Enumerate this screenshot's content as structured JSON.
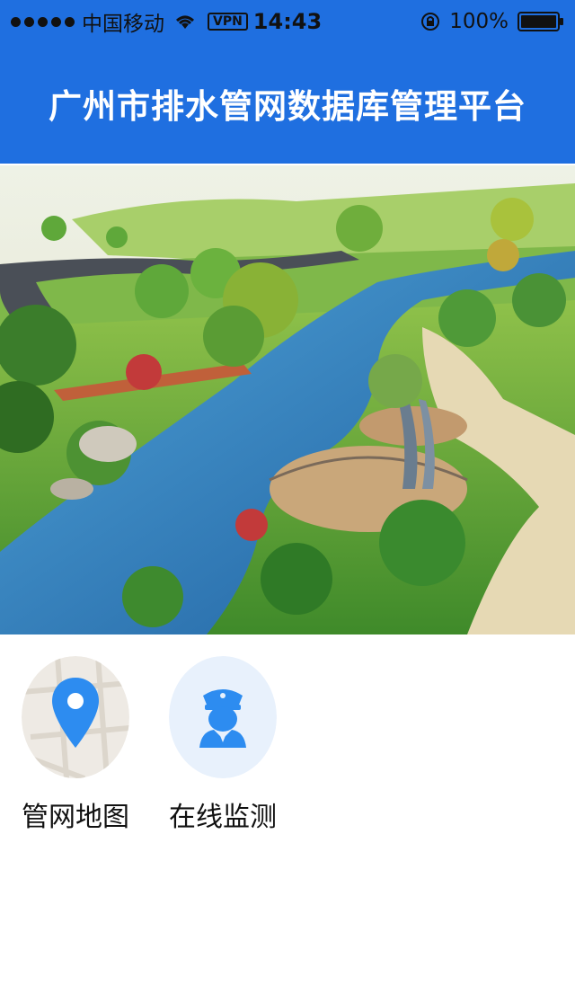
{
  "status_bar": {
    "carrier": "中国移动",
    "vpn": "VPN",
    "time": "14:43",
    "battery": "100%"
  },
  "header": {
    "title": "广州市排水管网数据库管理平台"
  },
  "banner": {
    "icon": "park-river-landscape-image"
  },
  "features": [
    {
      "label": "管网地图",
      "icon": "map-pin-icon"
    },
    {
      "label": "在线监测",
      "icon": "police-officer-icon"
    }
  ],
  "colors": {
    "primary": "#1f6fe0",
    "icon_blue": "#2d8cf0",
    "icon_circle_bg": "#e8f1fc"
  }
}
